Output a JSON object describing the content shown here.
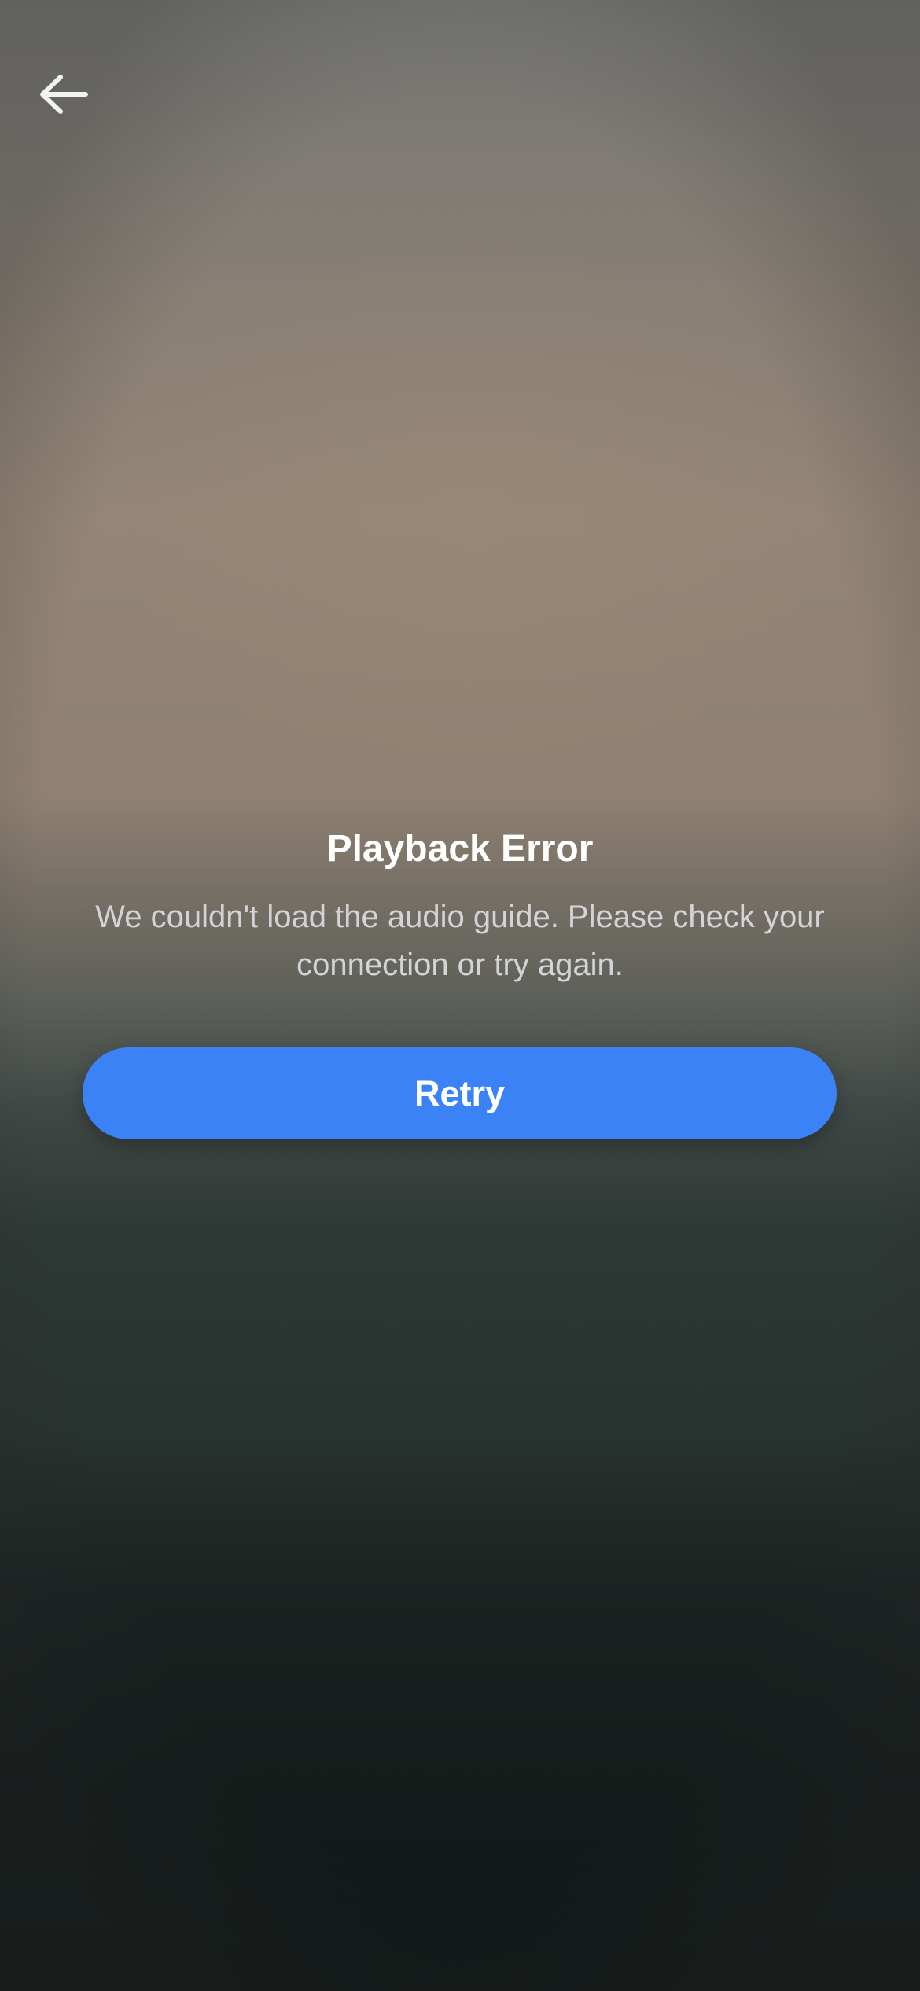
{
  "nav": {
    "back_icon": "arrow-left-icon"
  },
  "error": {
    "title": "Playback Error",
    "message": "We couldn't load the audio guide. Please check your connection or try again.",
    "retry_label": "Retry"
  },
  "colors": {
    "accent": "#3b82f6",
    "title": "#ffffff",
    "message": "#d4d4d8"
  }
}
